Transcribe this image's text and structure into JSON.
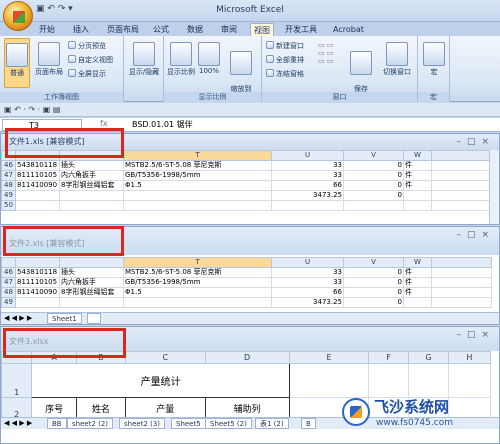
{
  "app": {
    "title": "Microsoft Excel",
    "qat": "▣ ↶ ↷ ▾"
  },
  "tabs": [
    "开始",
    "插入",
    "页面布局",
    "公式",
    "数据",
    "审阅",
    "视图",
    "开发工具",
    "Acrobat"
  ],
  "active_tab": "视图",
  "ribbon": {
    "workbook_views": {
      "label": "工作簿视图",
      "normal": "普通",
      "page_layout": "页面布局",
      "page_break": "分页预览",
      "custom": "自定义视图",
      "fullscreen": "全屏显示"
    },
    "show_hide": {
      "label": "显示/隐藏"
    },
    "zoom": {
      "label": "显示比例",
      "zoom": "显示比例",
      "hundred": "100%",
      "to_selection": "缩放到\n选定区域"
    },
    "window": {
      "label": "窗口",
      "new_window": "新建窗口",
      "arrange_all": "全部重排",
      "freeze": "冻结窗格",
      "save_workspace": "保存\n工作区",
      "switch_window": "切换窗口"
    },
    "macros": {
      "label": "宏",
      "macros": "宏"
    }
  },
  "formula_bar": {
    "name_box": "T3",
    "fx": "fx",
    "content": "BSD.01.01 锯伴"
  },
  "windows": [
    {
      "title": "文件1.xls  [兼容模式]",
      "columns": [
        "",
        "",
        "",
        "T",
        "U",
        "V",
        "W"
      ],
      "rows": [
        [
          "46",
          "543810118",
          "插头",
          "MSTB2.5/6-ST-5.08 菲尼克斯",
          "33",
          "0",
          "件"
        ],
        [
          "47",
          "811110105",
          "内六角扳手",
          "GB/T5356-1998/5mm",
          "33",
          "0",
          "件"
        ],
        [
          "48",
          "811410090",
          "8字形钢丝绳铝套",
          "Φ1.5",
          "66",
          "0",
          "件"
        ],
        [
          "49",
          "",
          "",
          "",
          "3473.25",
          "0",
          ""
        ],
        [
          "50",
          "",
          "",
          "",
          "",
          "",
          ""
        ]
      ]
    },
    {
      "title": "文件2.xls  [兼容模式]",
      "columns": [
        "",
        "",
        "",
        "T",
        "U",
        "V",
        "W"
      ],
      "rows": [
        [
          "46",
          "543810118",
          "插头",
          "MSTB2.5/6-ST-5.08 菲尼克斯",
          "33",
          "0",
          "件"
        ],
        [
          "47",
          "811110105",
          "内六角扳手",
          "GB/T5356-1998/5mm",
          "33",
          "0",
          "件"
        ],
        [
          "48",
          "811410090",
          "8字形钢丝绳铝套",
          "Φ1.5",
          "66",
          "0",
          "件"
        ],
        [
          "49",
          "",
          "",
          "",
          "3473.25",
          "0",
          ""
        ]
      ],
      "sheet_tab": "Sheet1"
    },
    {
      "title": "文件3.xlsx",
      "columns": [
        "A",
        "B",
        "C",
        "D",
        "E",
        "F",
        "G",
        "H"
      ],
      "cells": {
        "title": "产量统计",
        "h1": "序号",
        "h2": "姓名",
        "h3": "产量",
        "h4": "辅助列"
      },
      "row_labels": [
        "1",
        "2"
      ],
      "sheet_tabs": [
        "BB",
        "sheet2 (2)",
        "sheet2 (3)",
        "Sheet5",
        "Sheet5 (2)",
        "表1 (2)",
        "B"
      ]
    }
  ],
  "nav_arrows": "◀ ◀ ▶ ▶",
  "watermark": {
    "text": "飞沙系统网",
    "url": "www.fs0745.com"
  }
}
